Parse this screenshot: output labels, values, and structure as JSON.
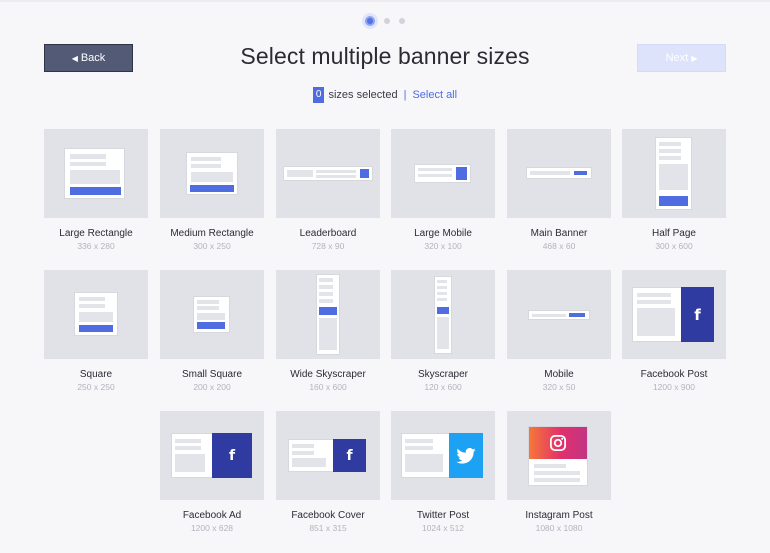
{
  "header": {
    "title": "Select multiple banner sizes",
    "back_label": "Back",
    "next_label": "Next",
    "back_icon": "caret-left-icon",
    "next_icon": "caret-right-icon"
  },
  "stepper": {
    "steps": 3,
    "active_step": 1
  },
  "selection": {
    "count": "0",
    "text": "sizes selected",
    "separator": "|",
    "select_all": "Select all"
  },
  "colors": {
    "accent": "#4f6ce0",
    "back_button": "#525a75",
    "next_button_disabled": "#dde3fb",
    "thumb_bg": "#e1e2e7"
  },
  "sizes": [
    {
      "label": "Large Rectangle",
      "dims": "336 x 280"
    },
    {
      "label": "Medium Rectangle",
      "dims": "300 x 250"
    },
    {
      "label": "Leaderboard",
      "dims": "728 x 90"
    },
    {
      "label": "Large Mobile",
      "dims": "320 x 100"
    },
    {
      "label": "Main Banner",
      "dims": "468 x 60"
    },
    {
      "label": "Half Page",
      "dims": "300 x 600"
    },
    {
      "label": "Square",
      "dims": "250 x 250"
    },
    {
      "label": "Small Square",
      "dims": "200 x 200"
    },
    {
      "label": "Wide Skyscraper",
      "dims": "160 x 600"
    },
    {
      "label": "Skyscraper",
      "dims": "120 x 600"
    },
    {
      "label": "Mobile",
      "dims": "320 x 50"
    },
    {
      "label": "Facebook Post",
      "dims": "1200 x 900"
    },
    {
      "label": "Facebook Ad",
      "dims": "1200 x 628"
    },
    {
      "label": "Facebook Cover",
      "dims": "851 x 315"
    },
    {
      "label": "Twitter Post",
      "dims": "1024 x 512"
    },
    {
      "label": "Instagram Post",
      "dims": "1080 x 1080"
    }
  ],
  "icons": {
    "facebook": "facebook-icon",
    "twitter": "twitter-icon",
    "instagram": "instagram-icon"
  }
}
